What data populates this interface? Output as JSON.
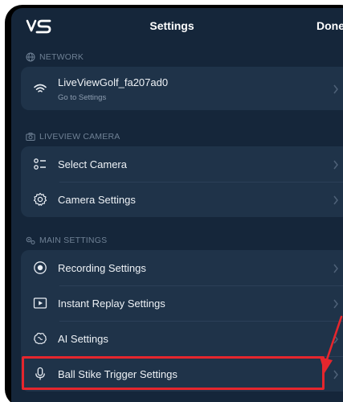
{
  "header": {
    "logo_text": "VS",
    "title": "Settings",
    "done_label": "Done"
  },
  "sections": {
    "network": {
      "header": "NETWORK",
      "items": [
        {
          "label": "LiveViewGolf_fa207ad0",
          "sub": "Go to Settings",
          "icon": "wifi-icon"
        }
      ]
    },
    "camera": {
      "header": "LIVEVIEW CAMERA",
      "items": [
        {
          "label": "Select Camera",
          "icon": "list-select-icon"
        },
        {
          "label": "Camera Settings",
          "icon": "gear-icon"
        }
      ]
    },
    "main": {
      "header": "MAIN SETTINGS",
      "items": [
        {
          "label": "Recording Settings",
          "icon": "record-icon"
        },
        {
          "label": "Instant Replay Settings",
          "icon": "play-box-icon"
        },
        {
          "label": "AI Settings",
          "icon": "brain-icon"
        },
        {
          "label": "Ball Stike Trigger Settings",
          "icon": "microphone-icon"
        }
      ]
    }
  },
  "annotation": {
    "highlight_color": "#e5262d",
    "target": "Ball Stike Trigger Settings"
  }
}
